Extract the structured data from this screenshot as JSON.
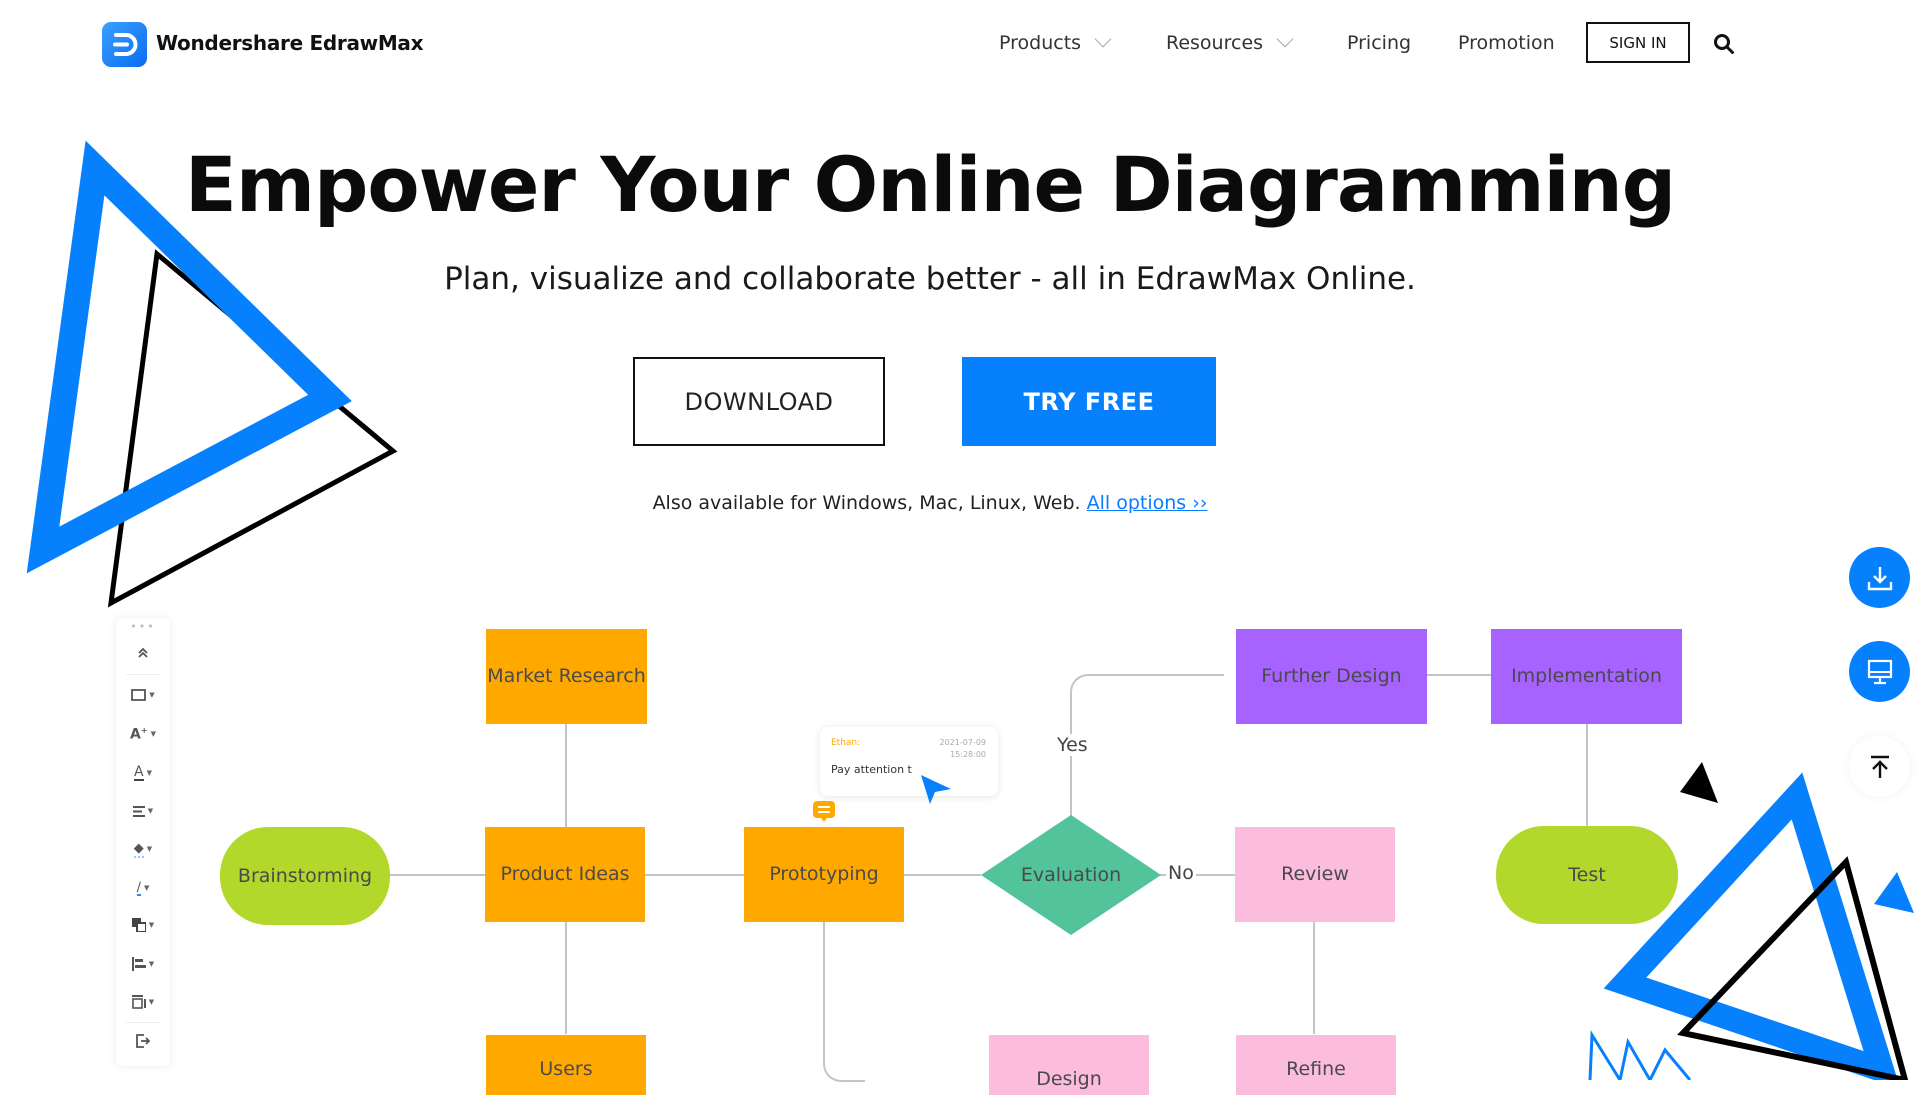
{
  "header": {
    "brand": "Wondershare EdrawMax",
    "logo_icon": "edrawmax-logo-icon",
    "nav": [
      {
        "label": "Products",
        "has_dropdown": true
      },
      {
        "label": "Resources",
        "has_dropdown": true
      },
      {
        "label": "Pricing",
        "has_dropdown": false
      },
      {
        "label": "Promotion",
        "has_dropdown": false
      }
    ],
    "sign_in_label": "SIGN IN",
    "search_icon": "search-icon"
  },
  "hero": {
    "title": "Empower Your Online Diagramming",
    "subtitle": "Plan, visualize and collaborate better - all in EdrawMax Online.",
    "download_label": "DOWNLOAD",
    "try_free_label": "TRY FREE",
    "availability_text": "Also available for Windows, Mac, Linux, Web.",
    "all_options_link": "All options ››"
  },
  "colors": {
    "accent_blue": "#0780fe",
    "node_orange": "#ffa900",
    "node_green": "#b1d82b",
    "node_purple": "#a663ff",
    "node_pink": "#fbbcdd",
    "decision_teal": "#53c39b"
  },
  "toolbar": {
    "items": [
      {
        "icon": "collapse-up-icon"
      },
      {
        "icon": "shape-rectangle-icon"
      },
      {
        "icon": "text-style-icon"
      },
      {
        "icon": "font-color-icon"
      },
      {
        "icon": "align-text-icon"
      },
      {
        "icon": "fill-bucket-icon"
      },
      {
        "icon": "line-color-icon"
      },
      {
        "icon": "arrange-icon"
      },
      {
        "icon": "align-objects-icon"
      },
      {
        "icon": "distribute-icon"
      },
      {
        "icon": "exit-icon"
      }
    ]
  },
  "diagram": {
    "nodes": {
      "market_research": "Market Research",
      "brainstorming": "Brainstorming",
      "product_ideas": "Product Ideas",
      "prototyping": "Prototyping",
      "evaluation": "Evaluation",
      "further_design": "Further Design",
      "implementation": "Implementation",
      "review": "Review",
      "test": "Test",
      "users": "Users",
      "design": "Design",
      "refine": "Refine"
    },
    "edge_labels": {
      "yes": "Yes",
      "no": "No"
    },
    "comment": {
      "author": "Ethan:",
      "date": "2021-07-09",
      "time": "15:28:00",
      "text": "Pay attention t"
    }
  },
  "side_actions": [
    {
      "icon": "download-icon"
    },
    {
      "icon": "desktop-icon"
    },
    {
      "icon": "back-to-top-icon"
    }
  ]
}
